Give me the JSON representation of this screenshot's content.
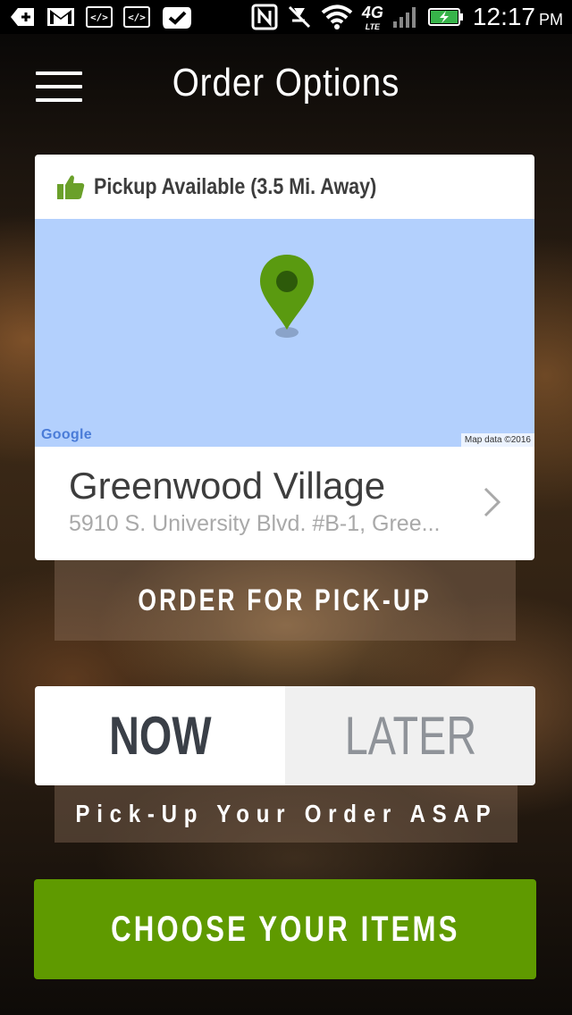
{
  "colors": {
    "brand_green": "#5f9a00",
    "pin_green": "#5a9a10",
    "pin_dot": "#2d5a0a",
    "map_water": "#b3d0fd",
    "thumb_green": "#6aa02a"
  },
  "status_bar": {
    "icons": [
      "add-icon",
      "gmail-icon",
      "code-icon",
      "code-icon",
      "check-badge-icon",
      "nfc-icon",
      "mute-icon",
      "wifi-icon",
      "4g-lte-icon",
      "signal-icon",
      "battery-charging-icon"
    ],
    "network_label": "4G",
    "network_sub": "LTE",
    "time": "12:17",
    "ampm": "PM"
  },
  "header": {
    "title": "Order Options",
    "menu_icon": "hamburger-menu-icon"
  },
  "pickup_card": {
    "status": "Pickup Available (3.5 Mi. Away)",
    "status_icon": "thumbs-up-icon",
    "map": {
      "logo": "Google",
      "attribution": "Map data ©2016",
      "pin_icon": "map-pin-icon"
    },
    "location_name": "Greenwood Village",
    "address": "5910 S. University Blvd. #B-1, Gree...",
    "chevron_icon": "chevron-right-icon"
  },
  "order_type_button": "ORDER FOR PICK-UP",
  "timing": {
    "options": [
      "NOW",
      "LATER"
    ],
    "selected": "NOW",
    "note": "Pick-Up Your Order ASAP"
  },
  "cta": {
    "label": "CHOOSE YOUR ITEMS"
  }
}
